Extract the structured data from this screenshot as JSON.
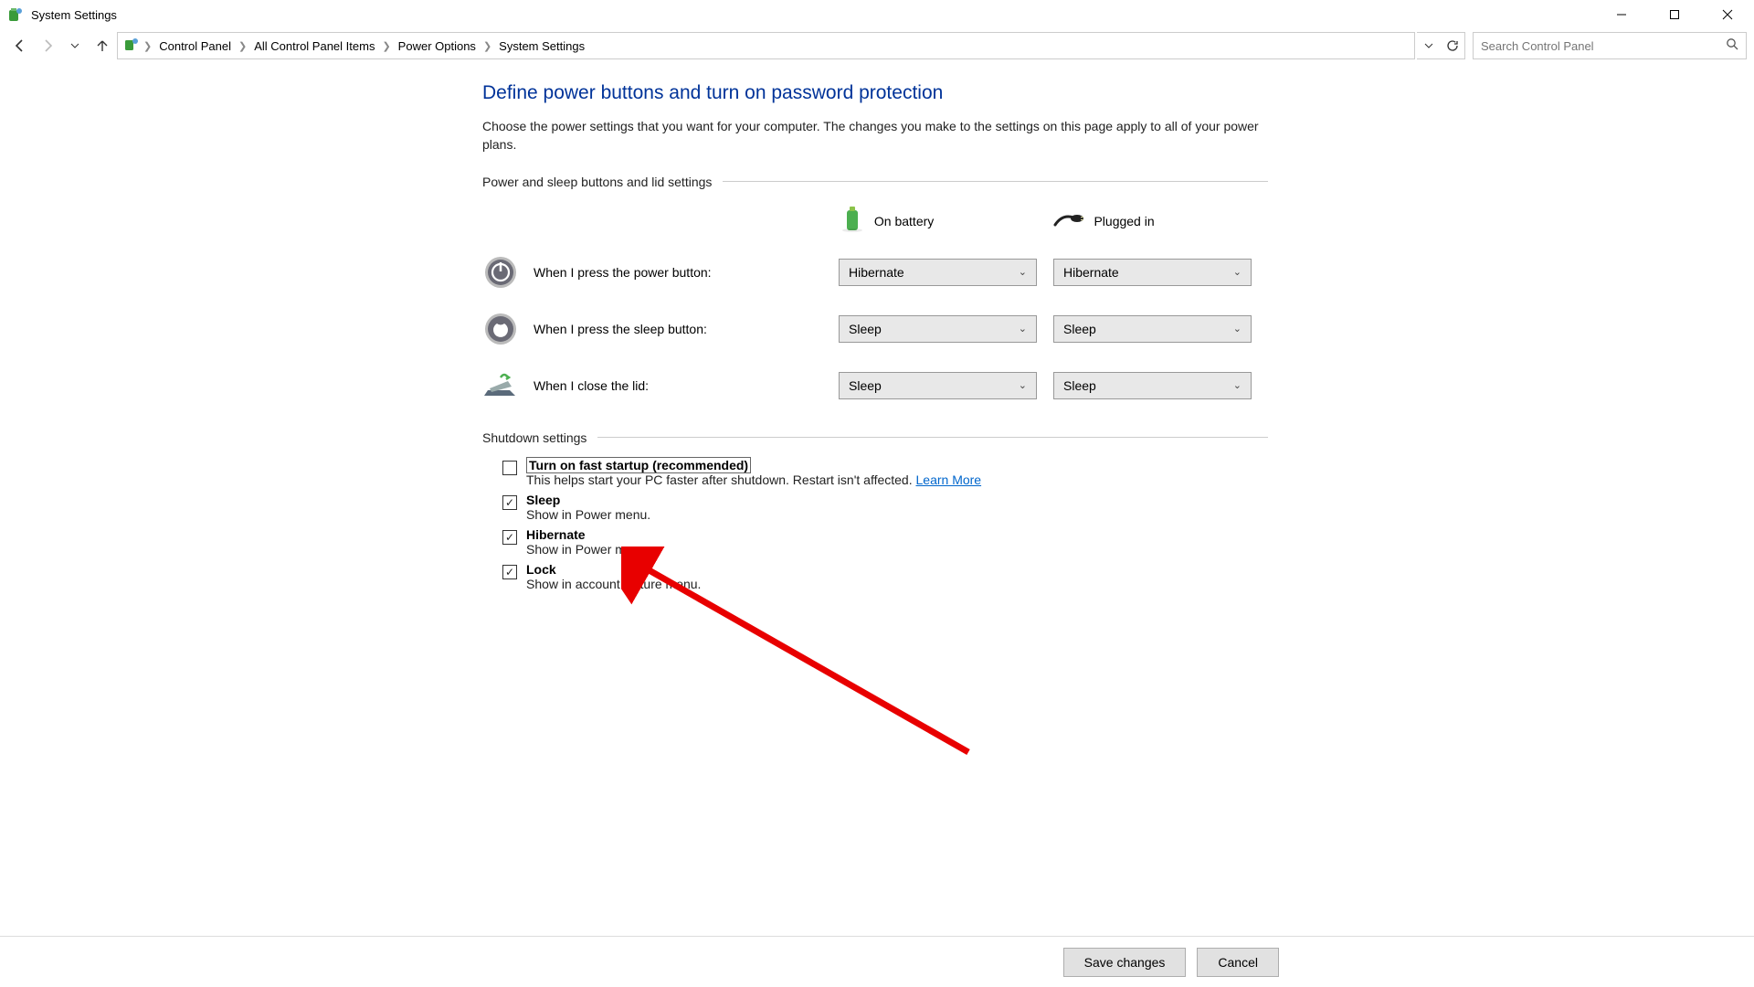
{
  "window": {
    "title": "System Settings",
    "search_placeholder": "Search Control Panel"
  },
  "breadcrumbs": [
    "Control Panel",
    "All Control Panel Items",
    "Power Options",
    "System Settings"
  ],
  "page": {
    "heading": "Define power buttons and turn on password protection",
    "subtitle": "Choose the power settings that you want for your computer. The changes you make to the settings on this page apply to all of your power plans."
  },
  "section1": {
    "label": "Power and sleep buttons and lid settings",
    "col_battery": "On battery",
    "col_plugged": "Plugged in",
    "rows": [
      {
        "label": "When I press the power button:",
        "battery": "Hibernate",
        "plugged": "Hibernate"
      },
      {
        "label": "When I press the sleep button:",
        "battery": "Sleep",
        "plugged": "Sleep"
      },
      {
        "label": "When I close the lid:",
        "battery": "Sleep",
        "plugged": "Sleep"
      }
    ]
  },
  "section2": {
    "label": "Shutdown settings",
    "items": [
      {
        "checked": false,
        "label": "Turn on fast startup (recommended)",
        "desc": "This helps start your PC faster after shutdown. Restart isn't affected. ",
        "link": "Learn More",
        "highlight": true
      },
      {
        "checked": true,
        "label": "Sleep",
        "desc": "Show in Power menu."
      },
      {
        "checked": true,
        "label": "Hibernate",
        "desc": "Show in Power menu."
      },
      {
        "checked": true,
        "label": "Lock",
        "desc": "Show in account picture menu."
      }
    ]
  },
  "footer": {
    "save": "Save changes",
    "cancel": "Cancel"
  }
}
